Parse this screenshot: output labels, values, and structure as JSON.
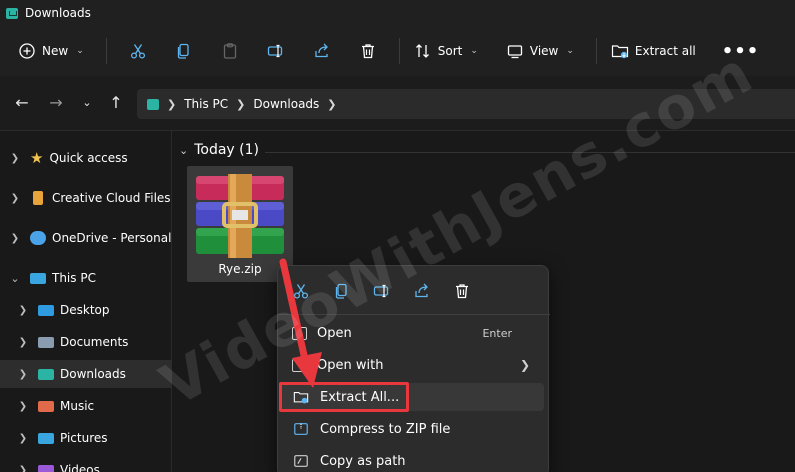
{
  "window": {
    "title": "Downloads"
  },
  "toolbar": {
    "new_label": "New",
    "sort_label": "Sort",
    "view_label": "View",
    "extract_all_label": "Extract all"
  },
  "address": {
    "crumbs": [
      "This PC",
      "Downloads"
    ]
  },
  "nav": {
    "items": [
      {
        "label": "Quick access"
      },
      {
        "label": "Creative Cloud Files"
      },
      {
        "label": "OneDrive - Personal"
      },
      {
        "label": "This PC"
      },
      {
        "label": "Desktop"
      },
      {
        "label": "Documents"
      },
      {
        "label": "Downloads"
      },
      {
        "label": "Music"
      },
      {
        "label": "Pictures"
      },
      {
        "label": "Videos"
      }
    ]
  },
  "content": {
    "group_label": "Today (1)",
    "file": {
      "name": "Rye.zip"
    }
  },
  "context_menu": {
    "items": [
      {
        "label": "Open",
        "shortcut": "Enter"
      },
      {
        "label": "Open with"
      },
      {
        "label": "Extract All..."
      },
      {
        "label": "Compress to ZIP file"
      },
      {
        "label": "Copy as path"
      }
    ]
  },
  "watermark": {
    "text": "VideoWithJens.com"
  },
  "colors": {
    "accent_red": "#e8383d",
    "folder_yellow": "#f0c34e",
    "selection_bg": "#2d2d2d"
  }
}
